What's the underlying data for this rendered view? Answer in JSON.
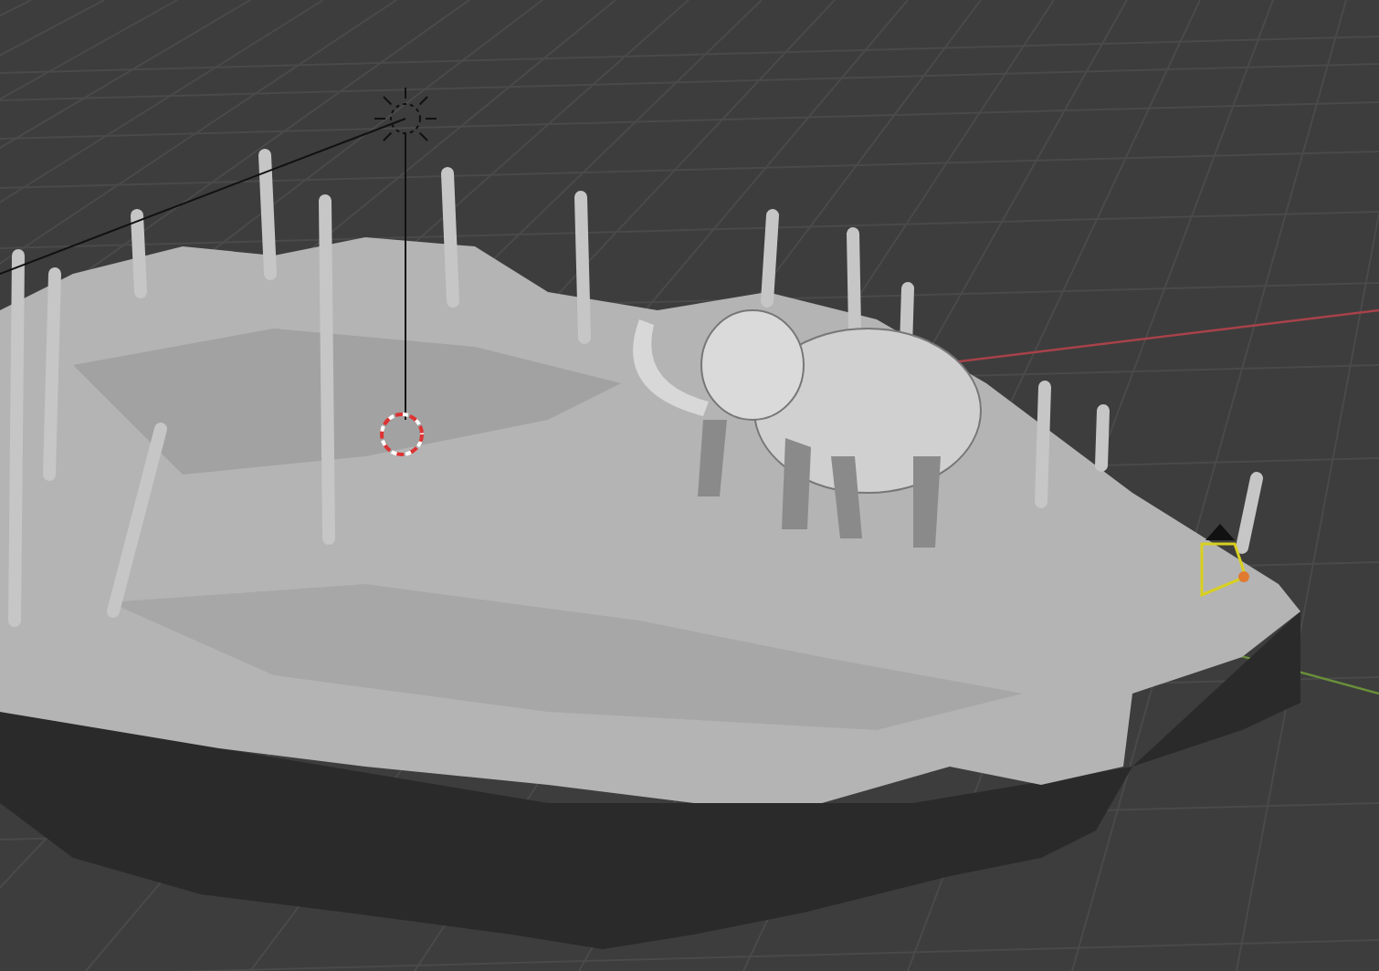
{
  "viewport": {
    "grid": true,
    "objects": [
      {
        "kind": "axis-x"
      },
      {
        "kind": "axis-y"
      },
      {
        "kind": "terrain"
      },
      {
        "kind": "trees"
      },
      {
        "kind": "mammoth"
      },
      {
        "kind": "light"
      },
      {
        "kind": "cursor"
      },
      {
        "kind": "camera"
      }
    ]
  }
}
